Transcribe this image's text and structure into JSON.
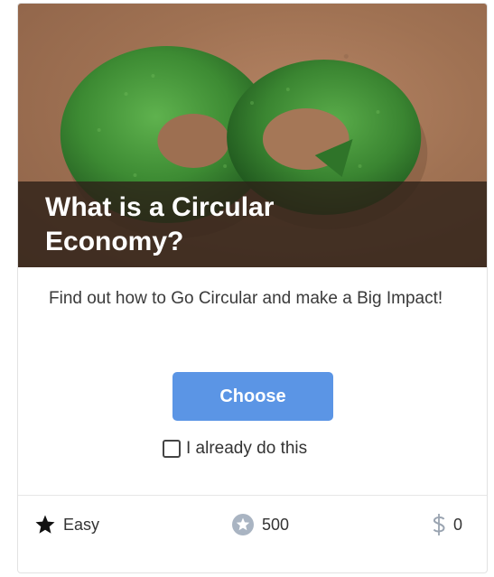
{
  "card": {
    "image_alt": "green grass infinity circular economy symbol on brown background",
    "title": "What is a Circular Economy?",
    "description": "Find out how to Go Circular and make a Big Impact!",
    "choose_label": "Choose",
    "already_label": "I already do this",
    "already_checked": false
  },
  "footer": {
    "difficulty": "Easy",
    "points": "500",
    "cost": "0"
  },
  "icons": {
    "difficulty": "star-icon",
    "points": "star-badge-icon",
    "cost": "dollar-icon"
  },
  "colors": {
    "button": "#5b95e5",
    "title_band": "#2d2018",
    "grass": "#3f8f36"
  }
}
